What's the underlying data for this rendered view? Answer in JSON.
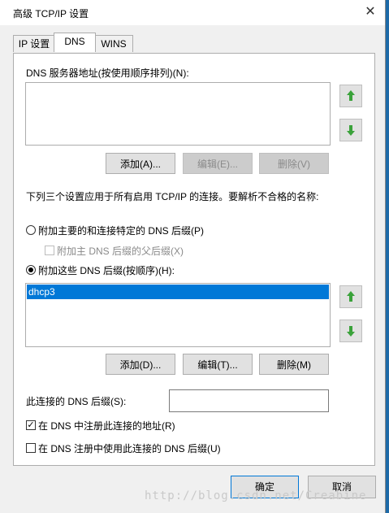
{
  "window": {
    "title": "高级 TCP/IP 设置",
    "close_glyph": "✕"
  },
  "tabs": [
    {
      "label": "IP 设置",
      "active": false
    },
    {
      "label": "DNS",
      "active": true
    },
    {
      "label": "WINS",
      "active": false
    }
  ],
  "dns_servers": {
    "label": "DNS 服务器地址(按使用顺序排列)(N):",
    "items": [],
    "add_label": "添加(A)...",
    "edit_label": "编辑(E)...",
    "remove_label": "删除(V)"
  },
  "info_text": "下列三个设置应用于所有启用 TCP/IP 的连接。要解析不合格的名称:",
  "options": {
    "primary_suffix_label": "附加主要的和连接特定的 DNS 后缀(P)",
    "parent_suffix_label": "附加主 DNS 后缀的父后缀(X)",
    "these_suffixes_label": "附加这些 DNS 后缀(按顺序)(H):"
  },
  "suffix_list": {
    "items": [
      "dhcp3"
    ],
    "add_label": "添加(D)...",
    "edit_label": "编辑(T)...",
    "remove_label": "删除(M)"
  },
  "connection_suffix": {
    "label": "此连接的 DNS 后缀(S):",
    "value": ""
  },
  "register_label": "在 DNS 中注册此连接的地址(R)",
  "use_suffix_label": "在 DNS 注册中使用此连接的 DNS 后缀(U)",
  "footer": {
    "ok_label": "确定",
    "cancel_label": "取消"
  },
  "watermark": "http://blog.csdn.net/Creabine",
  "colors": {
    "accent": "#0078d7",
    "arrow_green": "#3aa23a"
  }
}
